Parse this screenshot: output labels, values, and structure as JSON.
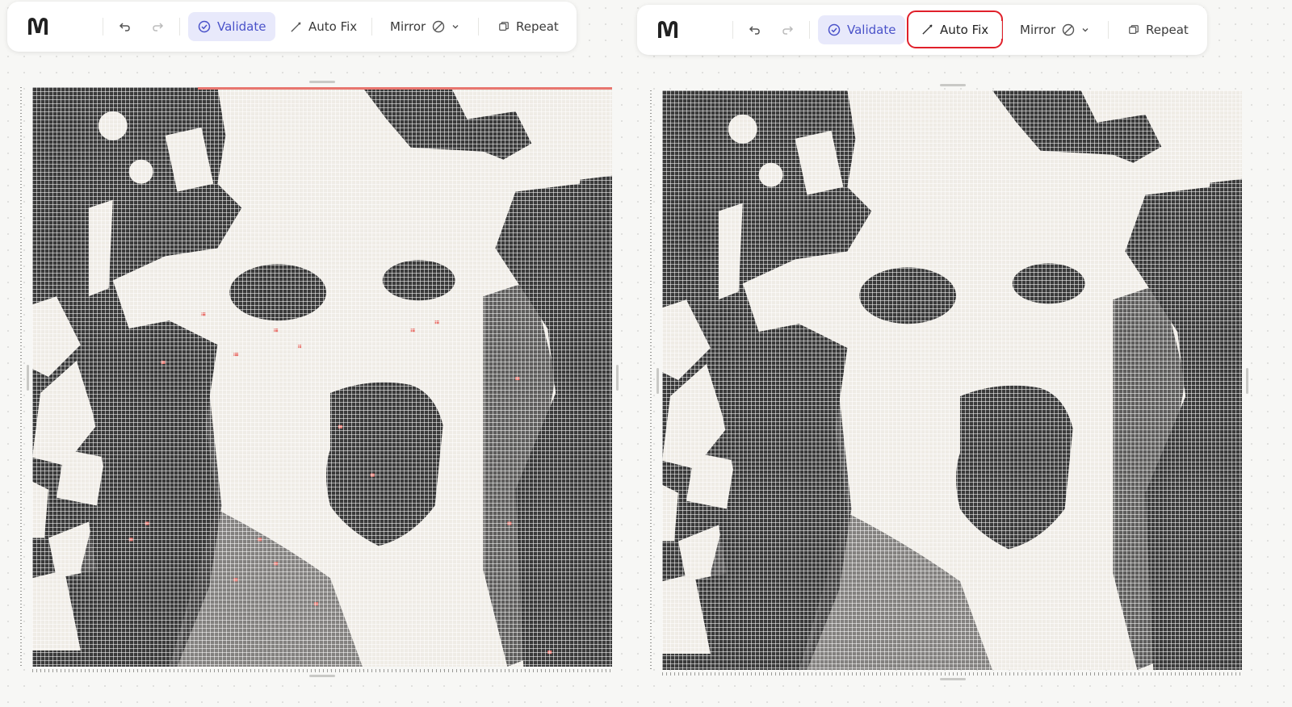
{
  "toolbar": {
    "validate_label": "Validate",
    "autofix_label": "Auto Fix",
    "mirror_label": "Mirror",
    "repeat_label": "Repeat"
  },
  "icons": {
    "logo": "brand-logo-icon",
    "undo": "undo-icon",
    "redo": "redo-icon",
    "validate": "check-circle-icon",
    "autofix": "wand-icon",
    "mirror": "prohibited-circle-icon",
    "dropdown": "chevron-down-icon",
    "repeat": "copy-icon"
  },
  "colors": {
    "validate_accent": "#4a52c9",
    "highlight": "#e0202a",
    "pixel_dark": "#3a3a3a",
    "pixel_light": "#efece6",
    "error_marker": "#e8766f"
  },
  "panels": [
    {
      "id": "before-autofix",
      "shows_error_markers": true
    },
    {
      "id": "after-autofix",
      "autofix_highlighted": true,
      "shows_error_markers": false
    }
  ]
}
